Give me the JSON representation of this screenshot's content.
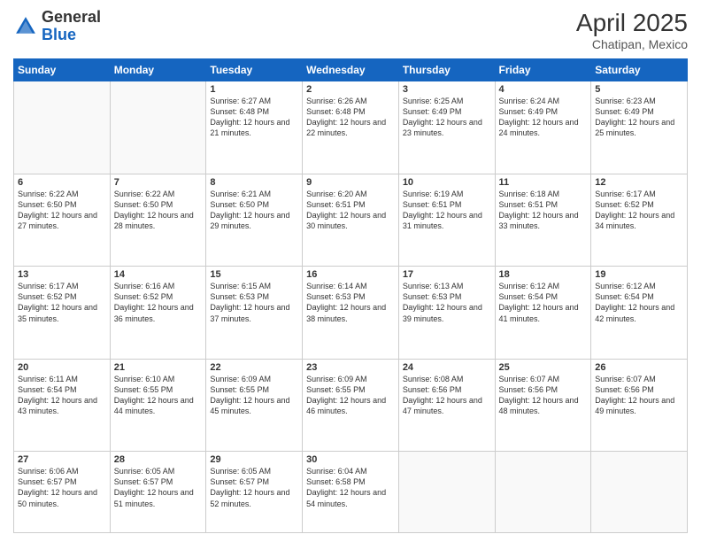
{
  "header": {
    "logo_general": "General",
    "logo_blue": "Blue",
    "month_title": "April 2025",
    "location": "Chatipan, Mexico"
  },
  "weekdays": [
    "Sunday",
    "Monday",
    "Tuesday",
    "Wednesday",
    "Thursday",
    "Friday",
    "Saturday"
  ],
  "weeks": [
    [
      {
        "day": "",
        "info": ""
      },
      {
        "day": "",
        "info": ""
      },
      {
        "day": "1",
        "info": "Sunrise: 6:27 AM\nSunset: 6:48 PM\nDaylight: 12 hours and 21 minutes."
      },
      {
        "day": "2",
        "info": "Sunrise: 6:26 AM\nSunset: 6:48 PM\nDaylight: 12 hours and 22 minutes."
      },
      {
        "day": "3",
        "info": "Sunrise: 6:25 AM\nSunset: 6:49 PM\nDaylight: 12 hours and 23 minutes."
      },
      {
        "day": "4",
        "info": "Sunrise: 6:24 AM\nSunset: 6:49 PM\nDaylight: 12 hours and 24 minutes."
      },
      {
        "day": "5",
        "info": "Sunrise: 6:23 AM\nSunset: 6:49 PM\nDaylight: 12 hours and 25 minutes."
      }
    ],
    [
      {
        "day": "6",
        "info": "Sunrise: 6:22 AM\nSunset: 6:50 PM\nDaylight: 12 hours and 27 minutes."
      },
      {
        "day": "7",
        "info": "Sunrise: 6:22 AM\nSunset: 6:50 PM\nDaylight: 12 hours and 28 minutes."
      },
      {
        "day": "8",
        "info": "Sunrise: 6:21 AM\nSunset: 6:50 PM\nDaylight: 12 hours and 29 minutes."
      },
      {
        "day": "9",
        "info": "Sunrise: 6:20 AM\nSunset: 6:51 PM\nDaylight: 12 hours and 30 minutes."
      },
      {
        "day": "10",
        "info": "Sunrise: 6:19 AM\nSunset: 6:51 PM\nDaylight: 12 hours and 31 minutes."
      },
      {
        "day": "11",
        "info": "Sunrise: 6:18 AM\nSunset: 6:51 PM\nDaylight: 12 hours and 33 minutes."
      },
      {
        "day": "12",
        "info": "Sunrise: 6:17 AM\nSunset: 6:52 PM\nDaylight: 12 hours and 34 minutes."
      }
    ],
    [
      {
        "day": "13",
        "info": "Sunrise: 6:17 AM\nSunset: 6:52 PM\nDaylight: 12 hours and 35 minutes."
      },
      {
        "day": "14",
        "info": "Sunrise: 6:16 AM\nSunset: 6:52 PM\nDaylight: 12 hours and 36 minutes."
      },
      {
        "day": "15",
        "info": "Sunrise: 6:15 AM\nSunset: 6:53 PM\nDaylight: 12 hours and 37 minutes."
      },
      {
        "day": "16",
        "info": "Sunrise: 6:14 AM\nSunset: 6:53 PM\nDaylight: 12 hours and 38 minutes."
      },
      {
        "day": "17",
        "info": "Sunrise: 6:13 AM\nSunset: 6:53 PM\nDaylight: 12 hours and 39 minutes."
      },
      {
        "day": "18",
        "info": "Sunrise: 6:12 AM\nSunset: 6:54 PM\nDaylight: 12 hours and 41 minutes."
      },
      {
        "day": "19",
        "info": "Sunrise: 6:12 AM\nSunset: 6:54 PM\nDaylight: 12 hours and 42 minutes."
      }
    ],
    [
      {
        "day": "20",
        "info": "Sunrise: 6:11 AM\nSunset: 6:54 PM\nDaylight: 12 hours and 43 minutes."
      },
      {
        "day": "21",
        "info": "Sunrise: 6:10 AM\nSunset: 6:55 PM\nDaylight: 12 hours and 44 minutes."
      },
      {
        "day": "22",
        "info": "Sunrise: 6:09 AM\nSunset: 6:55 PM\nDaylight: 12 hours and 45 minutes."
      },
      {
        "day": "23",
        "info": "Sunrise: 6:09 AM\nSunset: 6:55 PM\nDaylight: 12 hours and 46 minutes."
      },
      {
        "day": "24",
        "info": "Sunrise: 6:08 AM\nSunset: 6:56 PM\nDaylight: 12 hours and 47 minutes."
      },
      {
        "day": "25",
        "info": "Sunrise: 6:07 AM\nSunset: 6:56 PM\nDaylight: 12 hours and 48 minutes."
      },
      {
        "day": "26",
        "info": "Sunrise: 6:07 AM\nSunset: 6:56 PM\nDaylight: 12 hours and 49 minutes."
      }
    ],
    [
      {
        "day": "27",
        "info": "Sunrise: 6:06 AM\nSunset: 6:57 PM\nDaylight: 12 hours and 50 minutes."
      },
      {
        "day": "28",
        "info": "Sunrise: 6:05 AM\nSunset: 6:57 PM\nDaylight: 12 hours and 51 minutes."
      },
      {
        "day": "29",
        "info": "Sunrise: 6:05 AM\nSunset: 6:57 PM\nDaylight: 12 hours and 52 minutes."
      },
      {
        "day": "30",
        "info": "Sunrise: 6:04 AM\nSunset: 6:58 PM\nDaylight: 12 hours and 54 minutes."
      },
      {
        "day": "",
        "info": ""
      },
      {
        "day": "",
        "info": ""
      },
      {
        "day": "",
        "info": ""
      }
    ]
  ]
}
